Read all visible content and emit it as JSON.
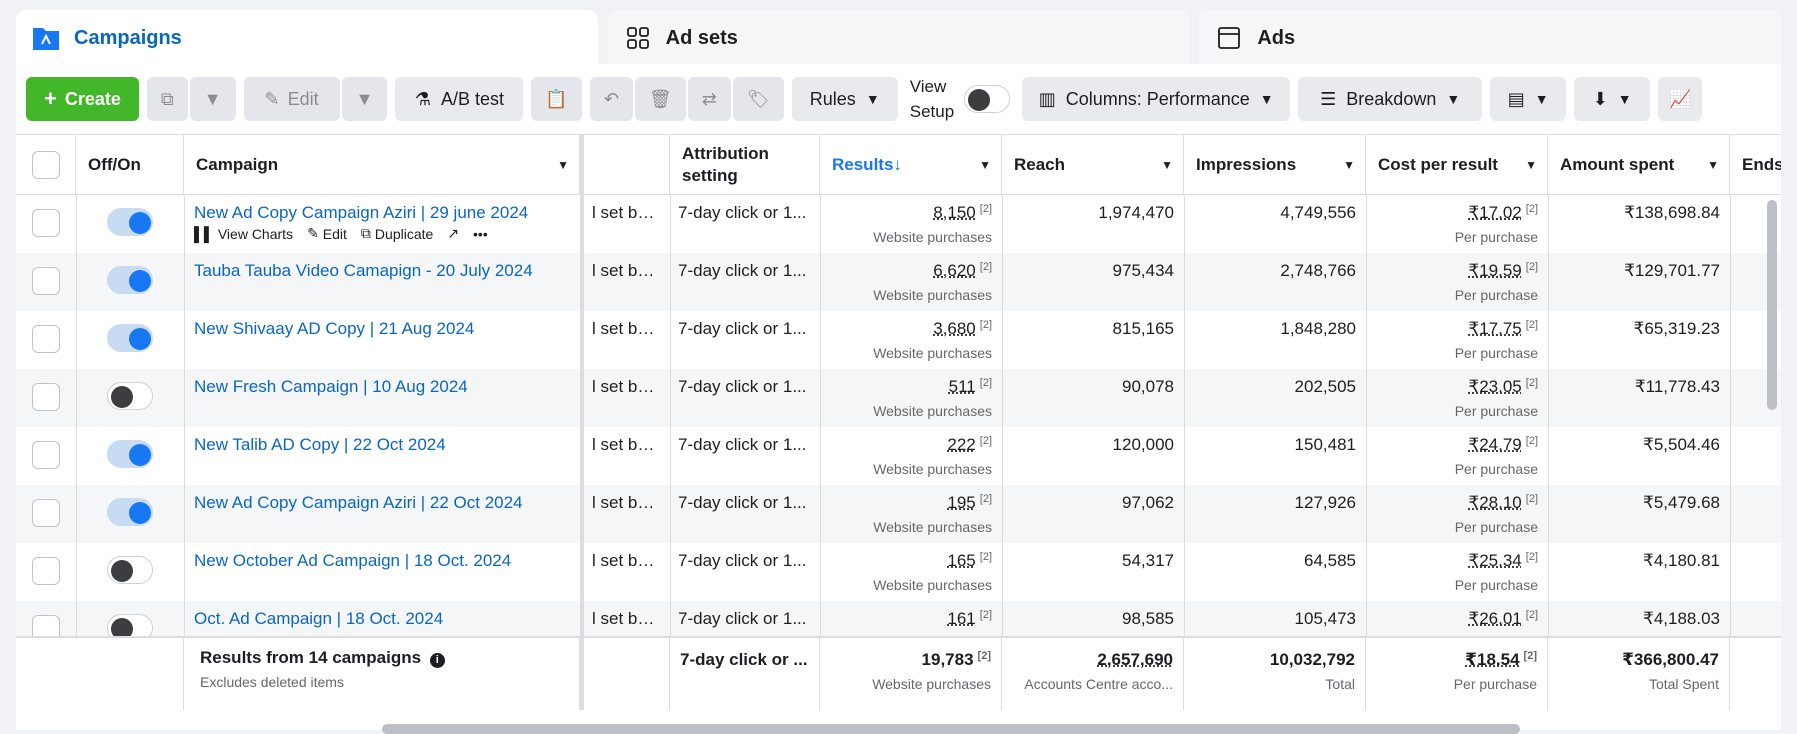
{
  "tabs": [
    {
      "label": "Campaigns",
      "icon": "folder-icon"
    },
    {
      "label": "Ad sets",
      "icon": "grid-icon"
    },
    {
      "label": "Ads",
      "icon": "ad-icon"
    }
  ],
  "toolbar": {
    "create": "Create",
    "edit": "Edit",
    "ab_test": "A/B test",
    "rules": "Rules",
    "view_setup_1": "View",
    "view_setup_2": "Setup",
    "columns": "Columns: Performance",
    "breakdown": "Breakdown"
  },
  "headers": {
    "offon": "Off/On",
    "campaign": "Campaign",
    "attribution": "Attribution setting",
    "results": "Results",
    "reach": "Reach",
    "impressions": "Impressions",
    "cost": "Cost per result",
    "amount": "Amount spent",
    "ends": "Ends"
  },
  "row_actions": {
    "charts": "View Charts",
    "edit": "Edit",
    "duplicate": "Duplicate"
  },
  "rows": [
    {
      "name": "New Ad Copy Campaign Aziri | 29 june 2024",
      "on": true,
      "budget": "l set bud...",
      "attr": "7-day click or 1...",
      "results": "8,150",
      "results_sub": "Website purchases",
      "reach": "1,974,470",
      "impressions": "4,749,556",
      "cost": "₹17.02",
      "cost_sub": "Per purchase",
      "amount": "₹138,698.84"
    },
    {
      "name": "Tauba Tauba Video Camapign - 20 July 2024",
      "on": true,
      "budget": "l set bud...",
      "attr": "7-day click or 1...",
      "results": "6,620",
      "results_sub": "Website purchases",
      "reach": "975,434",
      "impressions": "2,748,766",
      "cost": "₹19.59",
      "cost_sub": "Per purchase",
      "amount": "₹129,701.77"
    },
    {
      "name": "New Shivaay AD Copy | 21 Aug 2024",
      "on": true,
      "budget": "l set bud...",
      "attr": "7-day click or 1...",
      "results": "3,680",
      "results_sub": "Website purchases",
      "reach": "815,165",
      "impressions": "1,848,280",
      "cost": "₹17.75",
      "cost_sub": "Per purchase",
      "amount": "₹65,319.23"
    },
    {
      "name": "New Fresh Campaign | 10 Aug 2024",
      "on": false,
      "budget": "l set bud...",
      "attr": "7-day click or 1...",
      "results": "511",
      "results_sub": "Website purchases",
      "reach": "90,078",
      "impressions": "202,505",
      "cost": "₹23.05",
      "cost_sub": "Per purchase",
      "amount": "₹11,778.43"
    },
    {
      "name": "New Talib AD Copy | 22 Oct 2024",
      "on": true,
      "budget": "l set bud...",
      "attr": "7-day click or 1...",
      "results": "222",
      "results_sub": "Website purchases",
      "reach": "120,000",
      "impressions": "150,481",
      "cost": "₹24.79",
      "cost_sub": "Per purchase",
      "amount": "₹5,504.46"
    },
    {
      "name": "New Ad Copy Campaign Aziri | 22 Oct 2024",
      "on": true,
      "budget": "l set bud...",
      "attr": "7-day click or 1...",
      "results": "195",
      "results_sub": "Website purchases",
      "reach": "97,062",
      "impressions": "127,926",
      "cost": "₹28.10",
      "cost_sub": "Per purchase",
      "amount": "₹5,479.68"
    },
    {
      "name": "New October Ad Campaign | 18 Oct. 2024",
      "on": false,
      "budget": "l set bud...",
      "attr": "7-day click or 1...",
      "results": "165",
      "results_sub": "Website purchases",
      "reach": "54,317",
      "impressions": "64,585",
      "cost": "₹25.34",
      "cost_sub": "Per purchase",
      "amount": "₹4,180.81"
    },
    {
      "name": "Oct. Ad Campaign | 18 Oct. 2024",
      "on": false,
      "budget": "l set bud...",
      "attr": "7-day click or 1...",
      "results": "161",
      "results_sub": "Website purchases",
      "reach": "98,585",
      "impressions": "105,473",
      "cost": "₹26.01",
      "cost_sub": "Per purchase",
      "amount": "₹4,188.03"
    }
  ],
  "footer": {
    "title": "Results from 14 campaigns",
    "subtitle": "Excludes deleted items",
    "attr": "7-day click or ...",
    "results": "19,783",
    "results_sub": "Website purchases",
    "reach": "2,657,690",
    "reach_sub": "Accounts Centre acco...",
    "impressions": "10,032,792",
    "impressions_sub": "Total",
    "cost": "₹18.54",
    "cost_sub": "Per purchase",
    "amount": "₹366,800.47",
    "amount_sub": "Total Spent"
  },
  "sup_marker": "[2]",
  "colors": {
    "accent": "#0a66c2",
    "create": "#42b72a",
    "toggle_on": "#1877f2"
  }
}
